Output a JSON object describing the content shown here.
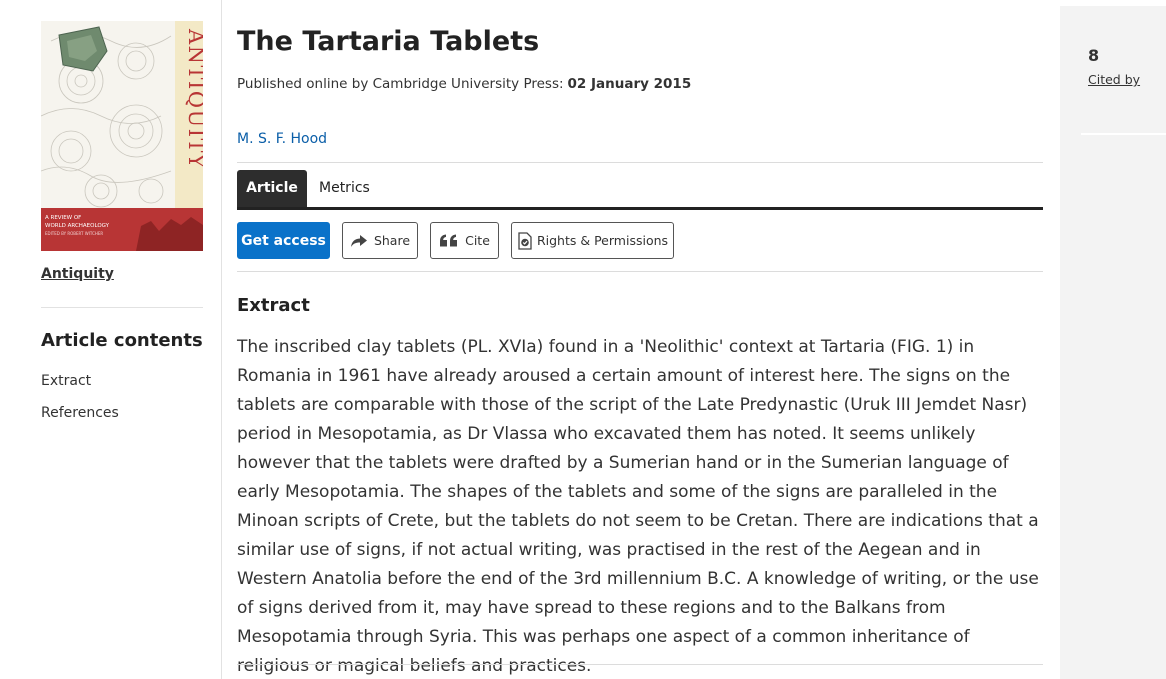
{
  "journal": {
    "cover": {
      "masthead": "ANTIQUITY",
      "tagline_lines": [
        "A REVIEW OF",
        "WORLD ARCHAEOLOGY"
      ],
      "editor_line": "EDITED BY ROBERT WITCHER",
      "colors": {
        "band": "#b83535",
        "masthead_bg": "#f3e9c6",
        "masthead_text": "#b83535"
      }
    },
    "link_label": "Antiquity"
  },
  "contents": {
    "title": "Article contents",
    "items": [
      "Extract",
      "References"
    ]
  },
  "article": {
    "title": "The Tartaria Tablets",
    "published_prefix": "Published online by Cambridge University Press:",
    "published_date": "02 January 2015",
    "author": "M. S. F. Hood",
    "tabs": [
      {
        "label": "Article",
        "active": true
      },
      {
        "label": "Metrics",
        "active": false
      }
    ],
    "actions": {
      "get_access": "Get access",
      "share": "Share",
      "cite": "Cite",
      "rights": "Rights & Permissions"
    },
    "section_heading": "Extract",
    "extract_text": "The inscribed clay tablets (PL. XVIa) found in a 'Neolithic' context at Tartaria (FIG. 1) in Romania in 1961 have already aroused a certain amount of interest here. The signs on the tablets are comparable with those of the script of the Late Predynastic (Uruk III Jemdet Nasr) period in Mesopotamia, as Dr Vlassa who excavated them has noted. It seems unlikely however that the tablets were drafted by a Sumerian hand or in the Sumerian language of early Mesopotamia. The shapes of the tablets and some of the signs are paralleled in the Minoan scripts of Crete, but the tablets do not seem to be Cretan. There are indications that a similar use of signs, if not actual writing, was practised in the rest of the Aegean and in Western Anatolia before the end of the 3rd millennium B.C. A knowledge of writing, or the use of signs derived from it, may have spread to these regions and to the Balkans from Mesopotamia through Syria. This was perhaps one aspect of a common inheritance of religious or magical beliefs and practices."
  },
  "metrics": {
    "cited_count": "8",
    "cited_label": "Cited by"
  },
  "colors": {
    "accent_blue": "#0a72c9",
    "link_blue": "#0a5ea8",
    "tab_active": "#2d2d2d"
  },
  "icons": [
    "share-arrow-icon",
    "quote-icon",
    "permissions-check-icon"
  ]
}
